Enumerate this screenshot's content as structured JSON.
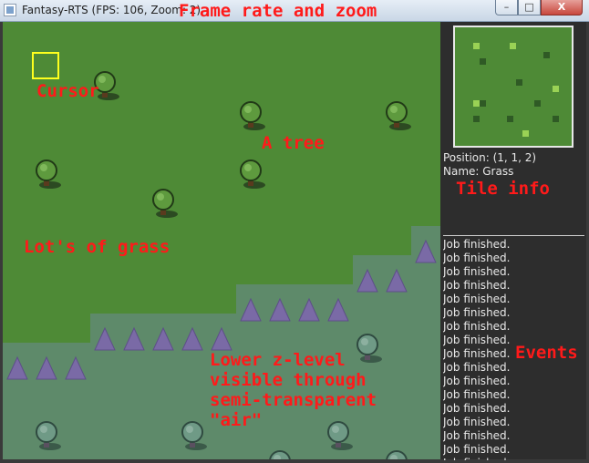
{
  "window": {
    "title": "Fantasy-RTS (FPS: 106, Zoom: 2)",
    "buttons": {
      "minimize": "–",
      "maximize": "□",
      "close": "X"
    }
  },
  "tile_info": {
    "position": "Position: (1, 1, 2)",
    "name": "Name: Grass"
  },
  "events": [
    "Job finished.",
    "Job finished.",
    "Job finished.",
    "Job finished.",
    "Job finished.",
    "Job finished.",
    "Job finished.",
    "Job finished.",
    "Job finished.",
    "Job finished.",
    "Job finished.",
    "Job finished.",
    "Job finished.",
    "Job finished.",
    "Job finished.",
    "Job finished.",
    "Job finished."
  ],
  "annotations": {
    "frame_rate": "Frame rate and zoom",
    "cursor": "Cursor",
    "tree": "A tree",
    "tile_info": "Tile info",
    "grass": "Lot's of grass",
    "events": "Events",
    "lower_z": "Lower z-level\nvisible through\nsemi-transparent\n\"air\""
  },
  "colors": {
    "grass": "#4e8a36",
    "lower_level": "#5e8a6a",
    "cursor": "#ffff1e",
    "annotation": "#ff1a1a",
    "panel": "#2d2d2d"
  }
}
